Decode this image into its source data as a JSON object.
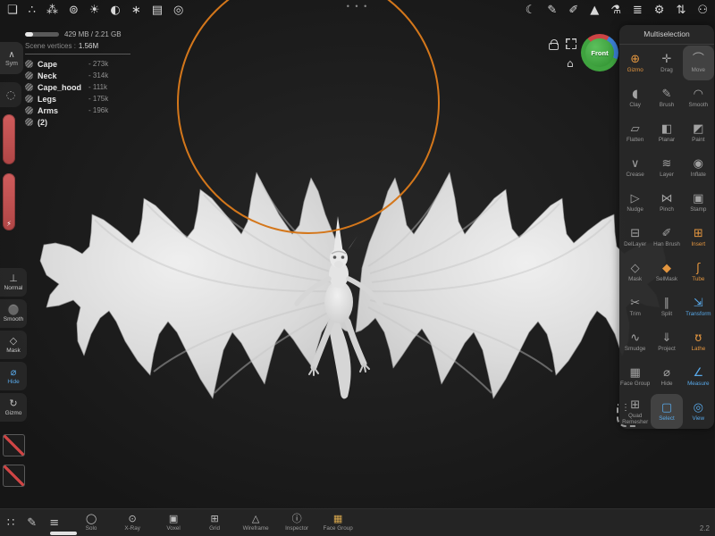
{
  "colors": {
    "accent_orange": "#e2953f",
    "accent_blue": "#58a8e8",
    "slider_red": "#c85454",
    "nav_green": "#3fa33f",
    "brush_circle_orange": "#d4771b"
  },
  "top_toolbar": {
    "center_dots": "• • •",
    "left_icons": [
      {
        "name": "folder-icon",
        "glyph": "❏"
      },
      {
        "name": "scene-graph-icon",
        "glyph": "∴"
      },
      {
        "name": "objects-spheres-icon",
        "glyph": "⁂"
      },
      {
        "name": "environment-icon",
        "glyph": "⊚"
      },
      {
        "name": "lighting-sun-icon",
        "glyph": "☀"
      },
      {
        "name": "material-sphere-icon",
        "glyph": "◐"
      },
      {
        "name": "postprocess-icon",
        "glyph": "∗"
      },
      {
        "name": "background-image-icon",
        "glyph": "▤"
      },
      {
        "name": "camera-icon",
        "glyph": "◎"
      }
    ],
    "right_icons": [
      {
        "name": "matcap-moon-icon",
        "glyph": "☾"
      },
      {
        "name": "pencil-icon",
        "glyph": "✎"
      },
      {
        "name": "stylus-icon",
        "glyph": "✐"
      },
      {
        "name": "prism-icon",
        "glyph": "▲"
      },
      {
        "name": "lab-flask-icon",
        "glyph": "⚗"
      },
      {
        "name": "layers-icon",
        "glyph": "≣"
      },
      {
        "name": "settings-gear-icon",
        "glyph": "⚙"
      },
      {
        "name": "sliders-icon",
        "glyph": "⇅"
      },
      {
        "name": "community-icon",
        "glyph": "⚇"
      }
    ]
  },
  "stats": {
    "memory_text": "429 MB / 2.21 GB",
    "vertices_label": "Scene vertices :",
    "vertices_value": "1.56M"
  },
  "scene_list": {
    "items": [
      {
        "name": "Cape",
        "count": "- 273k"
      },
      {
        "name": "Neck",
        "count": "- 314k"
      },
      {
        "name": "Cape_hood",
        "count": "- 111k"
      },
      {
        "name": "Legs",
        "count": "- 175k"
      },
      {
        "name": "Arms",
        "count": "- 196k"
      },
      {
        "name": "(2)",
        "count": ""
      }
    ]
  },
  "left_strip": {
    "sym_label": "Sym",
    "sym_glyph": "∧",
    "falloff_glyph": "◌",
    "bolt_glyph": "⚡"
  },
  "left_tools": [
    {
      "label": "Normal",
      "glyph": "⊥",
      "cls": ""
    },
    {
      "label": "Smooth",
      "glyph": "●",
      "cls": "sphere"
    },
    {
      "label": "Mask",
      "glyph": "◇",
      "cls": ""
    },
    {
      "label": "Hide",
      "glyph": "⌀",
      "cls": "blue"
    },
    {
      "label": "Gizmo",
      "glyph": "↻",
      "cls": ""
    }
  ],
  "nav": {
    "front_label": "Front",
    "home_glyph": "⌂"
  },
  "right_panel": {
    "title": "Multiselection",
    "tools": [
      {
        "label": "Gizmo",
        "glyph": "⊕",
        "cls": "orange",
        "icls": ""
      },
      {
        "label": "Drag",
        "glyph": "✛",
        "cls": "",
        "icls": ""
      },
      {
        "label": "Move",
        "glyph": "⌒",
        "cls": "boxed",
        "icls": ""
      },
      {
        "label": "Clay",
        "glyph": "◖",
        "cls": "",
        "icls": ""
      },
      {
        "label": "Brush",
        "glyph": "✎",
        "cls": "",
        "icls": ""
      },
      {
        "label": "Smooth",
        "glyph": "◠",
        "cls": "",
        "icls": ""
      },
      {
        "label": "Flatten",
        "glyph": "▱",
        "cls": "",
        "icls": ""
      },
      {
        "label": "Planar",
        "glyph": "◧",
        "cls": "",
        "icls": ""
      },
      {
        "label": "Paint",
        "glyph": "◩",
        "cls": "",
        "icls": ""
      },
      {
        "label": "Crease",
        "glyph": "∨",
        "cls": "",
        "icls": ""
      },
      {
        "label": "Layer",
        "glyph": "≋",
        "cls": "",
        "icls": ""
      },
      {
        "label": "Inflate",
        "glyph": "◉",
        "cls": "",
        "icls": ""
      },
      {
        "label": "Nudge",
        "glyph": "▷",
        "cls": "",
        "icls": ""
      },
      {
        "label": "Pinch",
        "glyph": "⋈",
        "cls": "",
        "icls": ""
      },
      {
        "label": "Stamp",
        "glyph": "▣",
        "cls": "",
        "icls": ""
      },
      {
        "label": "DelLayer",
        "glyph": "⊟",
        "cls": "",
        "icls": ""
      },
      {
        "label": "Han Brush",
        "glyph": "✐",
        "cls": "",
        "icls": ""
      },
      {
        "label": "Insert",
        "glyph": "⊞",
        "cls": "orange",
        "icls": ""
      },
      {
        "label": "Mask",
        "glyph": "◇",
        "cls": "",
        "icls": ""
      },
      {
        "label": "SelMask",
        "glyph": "◆",
        "cls": "",
        "icls": "orange"
      },
      {
        "label": "Tube",
        "glyph": "ʃ",
        "cls": "orange",
        "icls": ""
      },
      {
        "label": "Trim",
        "glyph": "✂",
        "cls": "",
        "icls": ""
      },
      {
        "label": "Split",
        "glyph": "∥",
        "cls": "",
        "icls": ""
      },
      {
        "label": "Transform",
        "glyph": "⇲",
        "cls": "blue",
        "icls": ""
      },
      {
        "label": "Smudge",
        "glyph": "∿",
        "cls": "",
        "icls": ""
      },
      {
        "label": "Project",
        "glyph": "⇓",
        "cls": "",
        "icls": ""
      },
      {
        "label": "Lathe",
        "glyph": "ʊ",
        "cls": "orange",
        "icls": ""
      },
      {
        "label": "Face Group",
        "glyph": "▦",
        "cls": "",
        "icls": ""
      },
      {
        "label": "Hide",
        "glyph": "⌀",
        "cls": "",
        "icls": ""
      },
      {
        "label": "Measure",
        "glyph": "∠",
        "cls": "blue",
        "icls": ""
      },
      {
        "label": "Quad Remesher",
        "glyph": "⊞",
        "cls": "",
        "icls": ""
      },
      {
        "label": "Select",
        "glyph": "▢",
        "cls": "blue boxed",
        "icls": ""
      },
      {
        "label": "View",
        "glyph": "◎",
        "cls": "blue",
        "icls": ""
      }
    ]
  },
  "bottom_bar": {
    "lead_icons": [
      {
        "name": "drag-handle-icon",
        "glyph": "∷"
      },
      {
        "name": "pencil-icon",
        "glyph": "✎"
      },
      {
        "name": "menu-list-icon",
        "glyph": "≡"
      }
    ],
    "toggles": [
      {
        "name": "solo-toggle",
        "label": "Solo",
        "glyph": "◯",
        "cls": ""
      },
      {
        "name": "xray-toggle",
        "label": "X-Ray",
        "glyph": "⊙",
        "cls": ""
      },
      {
        "name": "voxel-toggle",
        "label": "Voxel",
        "glyph": "▣",
        "cls": ""
      },
      {
        "name": "grid-toggle",
        "label": "Grid",
        "glyph": "⊞",
        "cls": ""
      },
      {
        "name": "wireframe-toggle",
        "label": "Wireframe",
        "glyph": "△",
        "cls": ""
      },
      {
        "name": "inspector-toggle",
        "label": "Inspector",
        "glyph": "ⓘ",
        "cls": ""
      },
      {
        "name": "facegroup-toggle",
        "label": "Face Group",
        "glyph": "▦",
        "cls": "warm"
      }
    ],
    "version": "2.2"
  }
}
